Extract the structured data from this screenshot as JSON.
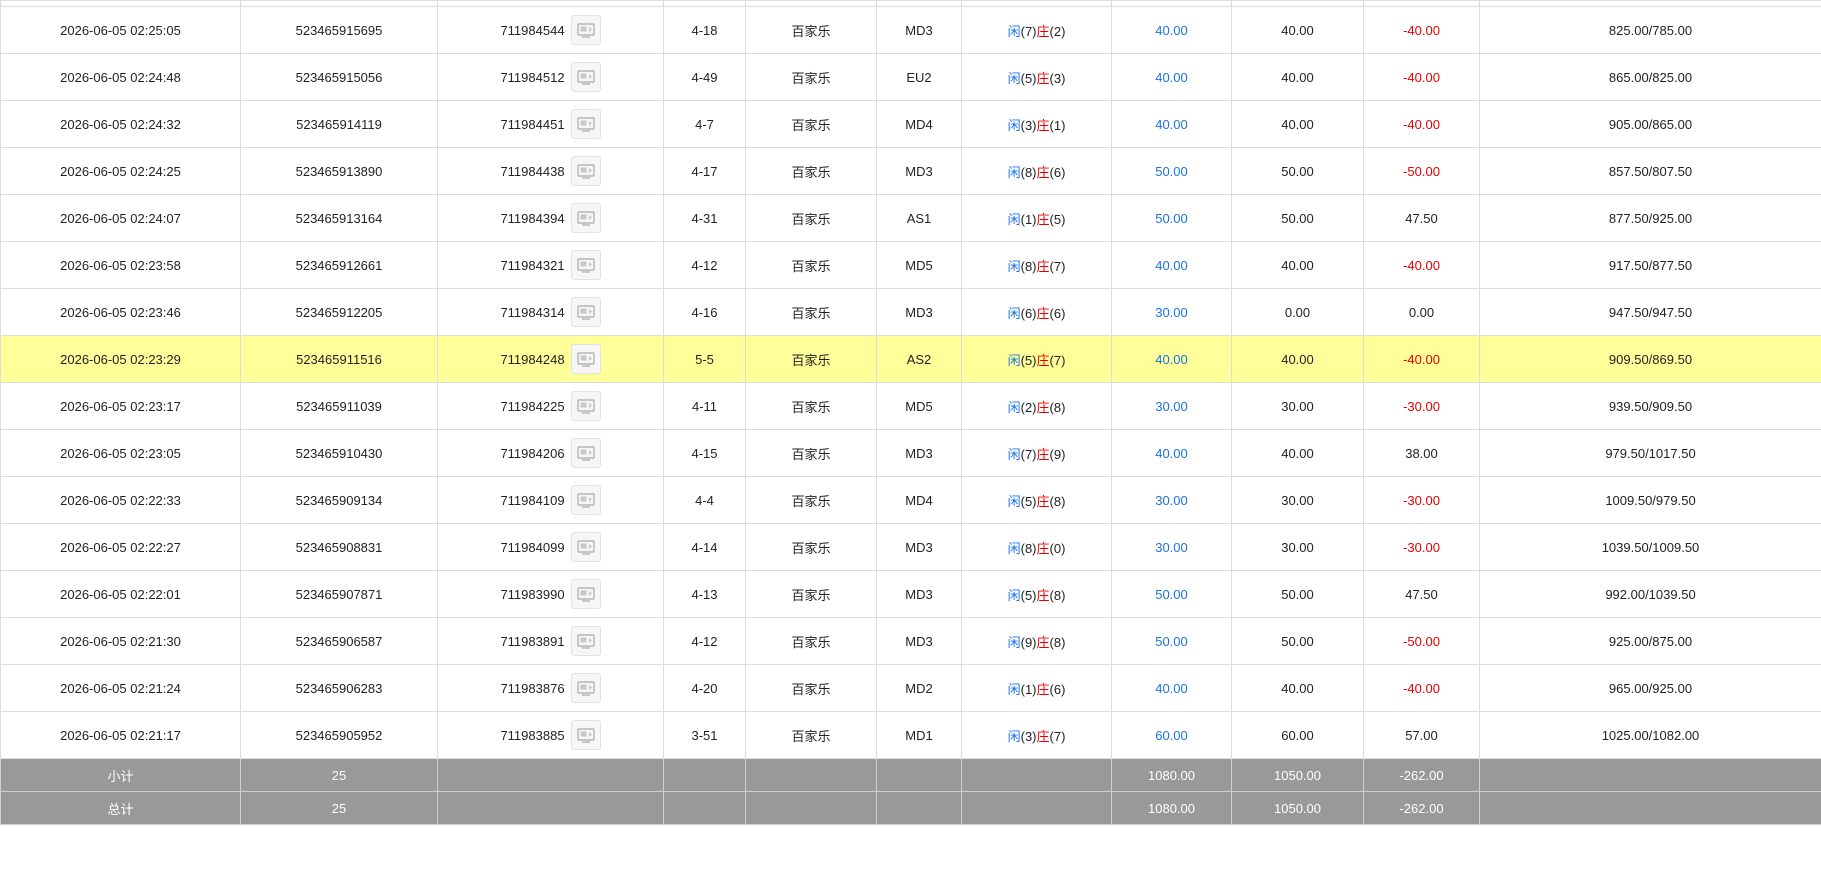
{
  "rows": [
    {
      "time": "2026-06-05 02:25:05",
      "bet_id": "523465915695",
      "game_id": "711984544",
      "round": "4-18",
      "game": "百家乐",
      "table": "MD3",
      "player_label": "闲",
      "player_score": "(7)",
      "banker_label": "庄",
      "banker_score": "(2)",
      "bet": "40.00",
      "valid": "40.00",
      "win": "-40.00",
      "win_color": "red",
      "balance": "825.00/785.00",
      "highlight": false
    },
    {
      "time": "2026-06-05 02:24:48",
      "bet_id": "523465915056",
      "game_id": "711984512",
      "round": "4-49",
      "game": "百家乐",
      "table": "EU2",
      "player_label": "闲",
      "player_score": "(5)",
      "banker_label": "庄",
      "banker_score": "(3)",
      "bet": "40.00",
      "valid": "40.00",
      "win": "-40.00",
      "win_color": "red",
      "balance": "865.00/825.00",
      "highlight": false
    },
    {
      "time": "2026-06-05 02:24:32",
      "bet_id": "523465914119",
      "game_id": "711984451",
      "round": "4-7",
      "game": "百家乐",
      "table": "MD4",
      "player_label": "闲",
      "player_score": "(3)",
      "banker_label": "庄",
      "banker_score": "(1)",
      "bet": "40.00",
      "valid": "40.00",
      "win": "-40.00",
      "win_color": "red",
      "balance": "905.00/865.00",
      "highlight": false
    },
    {
      "time": "2026-06-05 02:24:25",
      "bet_id": "523465913890",
      "game_id": "711984438",
      "round": "4-17",
      "game": "百家乐",
      "table": "MD3",
      "player_label": "闲",
      "player_score": "(8)",
      "banker_label": "庄",
      "banker_score": "(6)",
      "bet": "50.00",
      "valid": "50.00",
      "win": "-50.00",
      "win_color": "red",
      "balance": "857.50/807.50",
      "highlight": false
    },
    {
      "time": "2026-06-05 02:24:07",
      "bet_id": "523465913164",
      "game_id": "711984394",
      "round": "4-31",
      "game": "百家乐",
      "table": "AS1",
      "player_label": "闲",
      "player_score": "(1)",
      "banker_label": "庄",
      "banker_score": "(5)",
      "bet": "50.00",
      "valid": "50.00",
      "win": "47.50",
      "win_color": "normal",
      "balance": "877.50/925.00",
      "highlight": false
    },
    {
      "time": "2026-06-05 02:23:58",
      "bet_id": "523465912661",
      "game_id": "711984321",
      "round": "4-12",
      "game": "百家乐",
      "table": "MD5",
      "player_label": "闲",
      "player_score": "(8)",
      "banker_label": "庄",
      "banker_score": "(7)",
      "bet": "40.00",
      "valid": "40.00",
      "win": "-40.00",
      "win_color": "red",
      "balance": "917.50/877.50",
      "highlight": false
    },
    {
      "time": "2026-06-05 02:23:46",
      "bet_id": "523465912205",
      "game_id": "711984314",
      "round": "4-16",
      "game": "百家乐",
      "table": "MD3",
      "player_label": "闲",
      "player_score": "(6)",
      "banker_label": "庄",
      "banker_score": "(6)",
      "bet": "30.00",
      "valid": "0.00",
      "win": "0.00",
      "win_color": "normal",
      "balance": "947.50/947.50",
      "highlight": false
    },
    {
      "time": "2026-06-05 02:23:29",
      "bet_id": "523465911516",
      "game_id": "711984248",
      "round": "5-5",
      "game": "百家乐",
      "table": "AS2",
      "player_label": "闲",
      "player_score": "(5)",
      "banker_label": "庄",
      "banker_score": "(7)",
      "bet": "40.00",
      "valid": "40.00",
      "win": "-40.00",
      "win_color": "red",
      "balance": "909.50/869.50",
      "highlight": true
    },
    {
      "time": "2026-06-05 02:23:17",
      "bet_id": "523465911039",
      "game_id": "711984225",
      "round": "4-11",
      "game": "百家乐",
      "table": "MD5",
      "player_label": "闲",
      "player_score": "(2)",
      "banker_label": "庄",
      "banker_score": "(8)",
      "bet": "30.00",
      "valid": "30.00",
      "win": "-30.00",
      "win_color": "red",
      "balance": "939.50/909.50",
      "highlight": false
    },
    {
      "time": "2026-06-05 02:23:05",
      "bet_id": "523465910430",
      "game_id": "711984206",
      "round": "4-15",
      "game": "百家乐",
      "table": "MD3",
      "player_label": "闲",
      "player_score": "(7)",
      "banker_label": "庄",
      "banker_score": "(9)",
      "bet": "40.00",
      "valid": "40.00",
      "win": "38.00",
      "win_color": "normal",
      "balance": "979.50/1017.50",
      "highlight": false
    },
    {
      "time": "2026-06-05 02:22:33",
      "bet_id": "523465909134",
      "game_id": "711984109",
      "round": "4-4",
      "game": "百家乐",
      "table": "MD4",
      "player_label": "闲",
      "player_score": "(5)",
      "banker_label": "庄",
      "banker_score": "(8)",
      "bet": "30.00",
      "valid": "30.00",
      "win": "-30.00",
      "win_color": "red",
      "balance": "1009.50/979.50",
      "highlight": false
    },
    {
      "time": "2026-06-05 02:22:27",
      "bet_id": "523465908831",
      "game_id": "711984099",
      "round": "4-14",
      "game": "百家乐",
      "table": "MD3",
      "player_label": "闲",
      "player_score": "(8)",
      "banker_label": "庄",
      "banker_score": "(0)",
      "bet": "30.00",
      "valid": "30.00",
      "win": "-30.00",
      "win_color": "red",
      "balance": "1039.50/1009.50",
      "highlight": false
    },
    {
      "time": "2026-06-05 02:22:01",
      "bet_id": "523465907871",
      "game_id": "711983990",
      "round": "4-13",
      "game": "百家乐",
      "table": "MD3",
      "player_label": "闲",
      "player_score": "(5)",
      "banker_label": "庄",
      "banker_score": "(8)",
      "bet": "50.00",
      "valid": "50.00",
      "win": "47.50",
      "win_color": "normal",
      "balance": "992.00/1039.50",
      "highlight": false
    },
    {
      "time": "2026-06-05 02:21:30",
      "bet_id": "523465906587",
      "game_id": "711983891",
      "round": "4-12",
      "game": "百家乐",
      "table": "MD3",
      "player_label": "闲",
      "player_score": "(9)",
      "banker_label": "庄",
      "banker_score": "(8)",
      "bet": "50.00",
      "valid": "50.00",
      "win": "-50.00",
      "win_color": "red",
      "balance": "925.00/875.00",
      "highlight": false
    },
    {
      "time": "2026-06-05 02:21:24",
      "bet_id": "523465906283",
      "game_id": "711983876",
      "round": "4-20",
      "game": "百家乐",
      "table": "MD2",
      "player_label": "闲",
      "player_score": "(1)",
      "banker_label": "庄",
      "banker_score": "(6)",
      "bet": "40.00",
      "valid": "40.00",
      "win": "-40.00",
      "win_color": "red",
      "balance": "965.00/925.00",
      "highlight": false
    },
    {
      "time": "2026-06-05 02:21:17",
      "bet_id": "523465905952",
      "game_id": "711983885",
      "round": "3-51",
      "game": "百家乐",
      "table": "MD1",
      "player_label": "闲",
      "player_score": "(3)",
      "banker_label": "庄",
      "banker_score": "(7)",
      "bet": "60.00",
      "valid": "60.00",
      "win": "57.00",
      "win_color": "normal",
      "balance": "1025.00/1082.00",
      "highlight": false
    }
  ],
  "subtotal": {
    "label": "小计",
    "count": "25",
    "bet": "1080.00",
    "valid": "1050.00",
    "win": "-262.00"
  },
  "total": {
    "label": "总计",
    "count": "25",
    "bet": "1080.00",
    "valid": "1050.00",
    "win": "-262.00"
  },
  "icons": {
    "detail": "replay-detail-icon"
  },
  "colors": {
    "blue": "#1a73e8",
    "red": "#e60000",
    "highlight": "#ffff99",
    "summary_bg": "#999999"
  }
}
